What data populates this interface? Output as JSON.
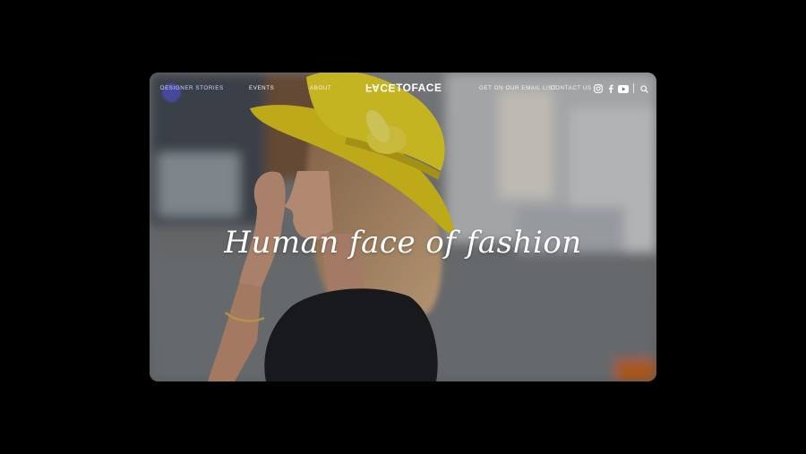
{
  "nav": {
    "links": [
      {
        "label": "DESIGNER STORIES",
        "active": true
      },
      {
        "label": "EVENTS"
      },
      {
        "label": "ABOUT"
      }
    ],
    "logo": {
      "mirrored": "FACE",
      "rest": "TOFACE"
    },
    "right_links": [
      {
        "label": "GET ON OUR EMAIL LIST"
      },
      {
        "label": "CONTACT US"
      }
    ],
    "icons": [
      "instagram-icon",
      "facebook-icon",
      "youtube-icon",
      "search-icon"
    ]
  },
  "hero": {
    "headline": "Human face of fashion"
  },
  "colors": {
    "accent": "#5050dc",
    "hat": "#e8cf1e",
    "background": "#000000"
  }
}
